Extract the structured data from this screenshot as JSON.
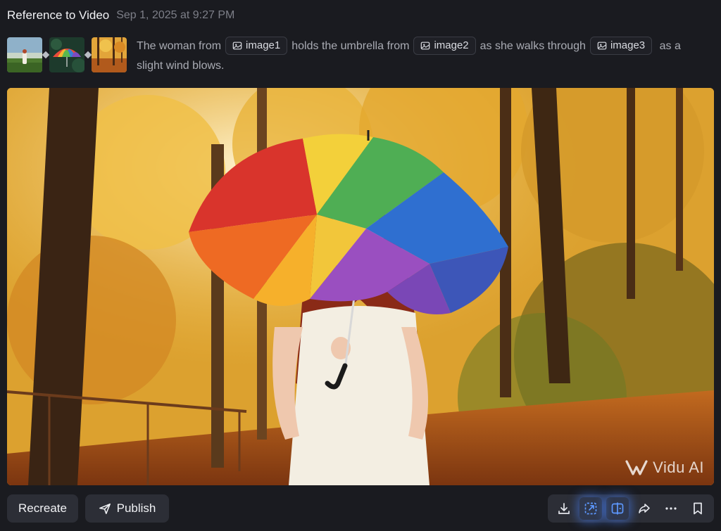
{
  "header": {
    "title": "Reference to Video",
    "timestamp": "Sep 1, 2025 at 9:27 PM"
  },
  "prompt": {
    "part1": "The woman from",
    "chip1": "image1",
    "part2": "holds the umbrella from",
    "chip2": "image2",
    "part3": "as she walks through",
    "chip3": "image3",
    "part4": "as a slight wind blows."
  },
  "reference_images": [
    {
      "name": "image1",
      "icon": "woman-in-field-thumbnail"
    },
    {
      "name": "image2",
      "icon": "rainbow-umbrella-thumbnail"
    },
    {
      "name": "image3",
      "icon": "autumn-forest-thumbnail"
    }
  ],
  "video": {
    "watermark": "Vidu AI",
    "description_icon": "woman-with-rainbow-umbrella-autumn-forest"
  },
  "footer": {
    "recreate_label": "Recreate",
    "publish_label": "Publish",
    "tools": [
      {
        "name": "download",
        "icon": "download-icon",
        "active": false
      },
      {
        "name": "upscale",
        "icon": "upscale-icon",
        "active": true
      },
      {
        "name": "extend",
        "icon": "extend-icon",
        "active": true
      },
      {
        "name": "share",
        "icon": "share-icon",
        "active": false
      },
      {
        "name": "more",
        "icon": "more-icon",
        "active": false
      },
      {
        "name": "bookmark",
        "icon": "bookmark-icon",
        "active": false
      }
    ]
  },
  "colors": {
    "background": "#1a1b20",
    "accent": "#5d98ff",
    "button": "#2c2e36"
  }
}
